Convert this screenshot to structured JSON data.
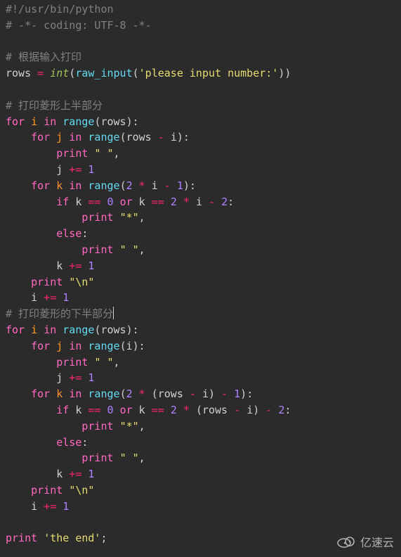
{
  "code": {
    "l01_shebang": "#!/usr/bin/python",
    "l02_coding": "# -*- coding: UTF-8 -*-",
    "l03_blank": "",
    "l04_c1": "# 根据输入打印",
    "l05_rows": "rows",
    "l05_eq": " = ",
    "l05_int": "int",
    "l05_raw": "raw_input",
    "l05_prompt": "'please input number:'",
    "l06_blank": "",
    "l07_c2": "# 打印菱形上半部分",
    "kw_for": "for",
    "kw_in": "in",
    "kw_if": "if",
    "kw_or": "or",
    "kw_else": "else",
    "bi_range": "range",
    "bi_print": "print",
    "var_i": "i",
    "var_j": "j",
    "var_k": "k",
    "var_rows": "rows",
    "n0": "0",
    "n1": "1",
    "n2": "2",
    "str_space": "\" \"",
    "str_star": "\"*\"",
    "str_nl": "\"\\n\"",
    "l21_c3": "# 打印菱形的下半部分",
    "str_end": "'the end'",
    "op_pluseq": " += ",
    "op_minus": " - ",
    "op_times": " * ",
    "op_eqeq": " == ",
    "colon": ":",
    "comma": ",",
    "semi": ";",
    "lp": "(",
    "rp": ")"
  },
  "watermark": {
    "text": "亿速云"
  }
}
